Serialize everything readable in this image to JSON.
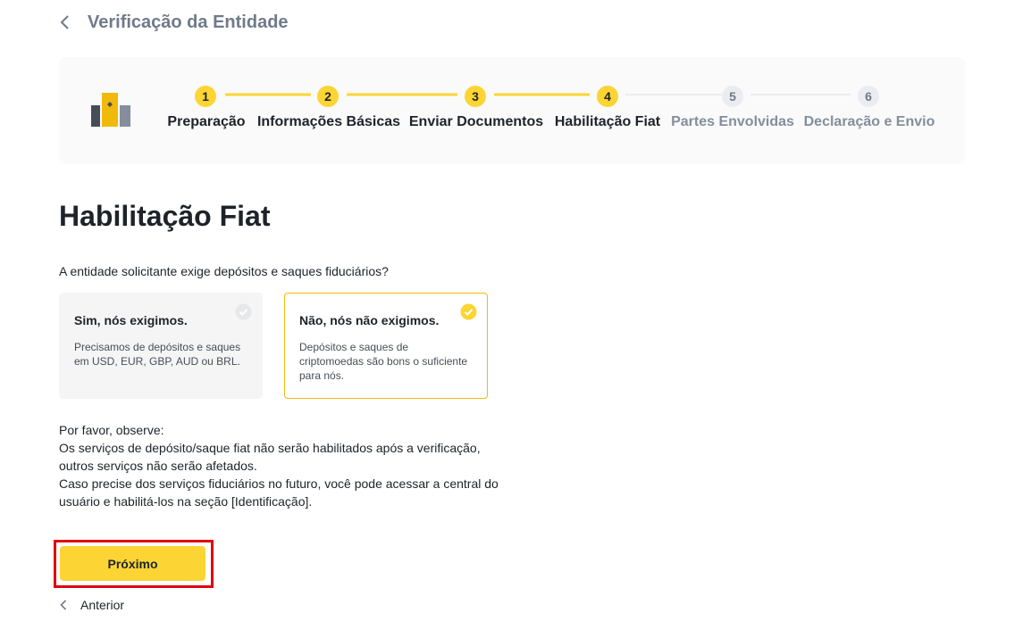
{
  "header": {
    "back_icon": "chevron-left-icon",
    "title": "Verificação da Entidade"
  },
  "stepper": {
    "logo_icon": "entity-building-icon",
    "steps": [
      {
        "number": "1",
        "label": "Preparação",
        "status": "done"
      },
      {
        "number": "2",
        "label": "Informações Básicas",
        "status": "done"
      },
      {
        "number": "3",
        "label": "Enviar Documentos",
        "status": "done"
      },
      {
        "number": "4",
        "label": "Habilitação Fiat",
        "status": "current"
      },
      {
        "number": "5",
        "label": "Partes Envolvidas",
        "status": "todo"
      },
      {
        "number": "6",
        "label": "Declaração e Envio",
        "status": "todo"
      }
    ]
  },
  "main": {
    "title": "Habilitação Fiat",
    "question": "A entidade solicitante exige depósitos e saques fiduciários?",
    "options": [
      {
        "title": "Sim, nós exigimos.",
        "description": "Precisamos de depósitos e saques em USD, EUR, GBP, AUD ou BRL.",
        "selected": false
      },
      {
        "title": "Não, nós não exigimos.",
        "description": "Depósitos e saques de criptomoedas são bons o suficiente para nós.",
        "selected": true
      }
    ],
    "note": {
      "heading": "Por favor, observe:",
      "line1": "Os serviços de depósito/saque fiat não serão habilitados após a verificação, outros serviços não serão afetados.",
      "line2": "Caso precise dos serviços fiduciários no futuro, você pode acessar a central do usuário e habilitá-los na seção [Identificação]."
    }
  },
  "actions": {
    "next_label": "Próximo",
    "prev_label": "Anterior",
    "prev_icon": "chevron-left-icon"
  },
  "colors": {
    "accent": "#fcd535",
    "selected_border": "#f0b90b",
    "highlight": "#e0000e"
  }
}
